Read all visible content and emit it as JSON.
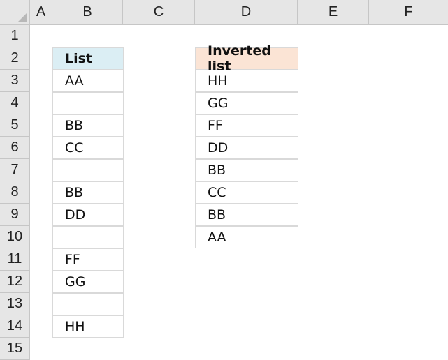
{
  "columns": [
    "A",
    "B",
    "C",
    "D",
    "E",
    "F"
  ],
  "rows": [
    "1",
    "2",
    "3",
    "4",
    "5",
    "6",
    "7",
    "8",
    "9",
    "10",
    "11",
    "12",
    "13",
    "14",
    "15"
  ],
  "list": {
    "header": "List",
    "items": [
      "AA",
      "",
      "BB",
      "CC",
      "",
      "BB",
      "DD",
      "",
      "FF",
      "GG",
      "",
      "HH"
    ]
  },
  "inverted": {
    "header": "Inverted list",
    "items": [
      "HH",
      "GG",
      "FF",
      "DD",
      "BB",
      "CC",
      "BB",
      "AA"
    ]
  }
}
